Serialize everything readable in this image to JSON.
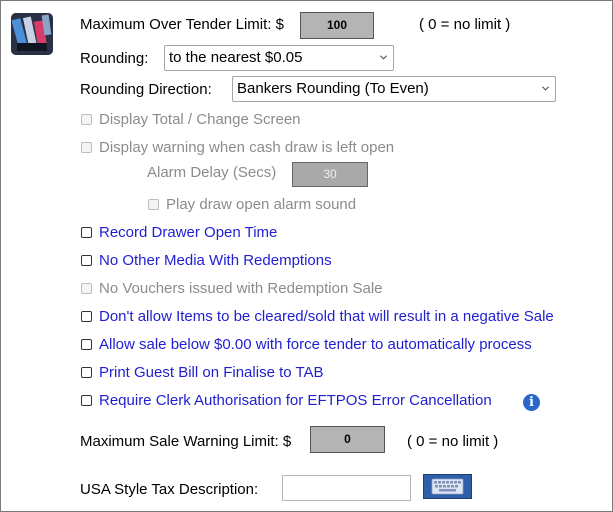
{
  "max_over_tender": {
    "label": "Maximum Over Tender Limit: $",
    "value": "100",
    "hint": "( 0 = no limit )"
  },
  "rounding": {
    "label": "Rounding:",
    "selected": "to the nearest $0.05"
  },
  "rounding_direction": {
    "label": "Rounding Direction:",
    "selected": "Bankers Rounding (To Even)"
  },
  "options": {
    "display_total": "Display Total / Change Screen",
    "cash_draw_warning": "Display warning when cash draw is left open",
    "alarm_delay_label": "Alarm Delay (Secs)",
    "alarm_delay_value": "30",
    "play_alarm": "Play draw open alarm sound",
    "record_drawer": "Record Drawer Open Time",
    "no_other_media": "No Other Media With Redemptions",
    "no_vouchers": "No Vouchers issued with Redemption Sale",
    "dont_allow_negative": "Don't allow Items to be cleared/sold that will result in a negative Sale",
    "allow_sale_below": "Allow sale below $0.00 with force tender to automatically process",
    "print_guest_bill": "Print Guest Bill on Finalise to TAB",
    "require_clerk_auth": "Require Clerk Authorisation for EFTPOS Error Cancellation"
  },
  "max_sale_warning": {
    "label": "Maximum Sale Warning Limit: $",
    "value": "0",
    "hint": "( 0 = no limit )"
  },
  "usa_tax": {
    "label": "USA Style Tax Description:",
    "value": ""
  },
  "icons": {
    "logo": "pos-terminal-logo-icon",
    "info": "info-icon",
    "keyboard": "keyboard-icon",
    "chevron": "chevron-down-icon"
  },
  "colors": {
    "link_blue": "#1f1fd1",
    "disabled_grey": "#8c8c8c",
    "field_grey": "#b4b4b4"
  }
}
